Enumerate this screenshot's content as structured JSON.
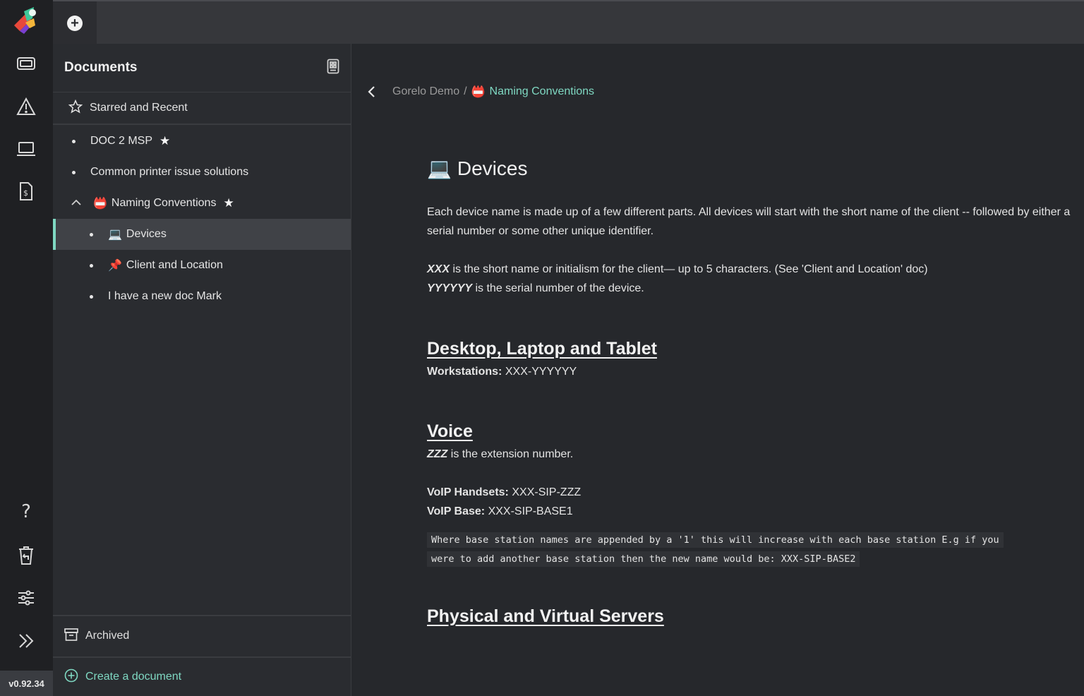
{
  "app": {
    "version": "v0.92.34"
  },
  "rail": {
    "icons": [
      "tickets-icon",
      "alert-icon",
      "laptop-icon",
      "invoice-icon",
      "help-icon",
      "trash-restore-icon",
      "settings-sliders-icon",
      "expand-icon"
    ]
  },
  "docs": {
    "title": "Documents",
    "starred_label": "Starred and Recent",
    "items": [
      {
        "label": "DOC 2 MSP",
        "starred": true
      },
      {
        "label": "Common printer issue solutions",
        "starred": false
      },
      {
        "label": "Naming Conventions",
        "emoji": "📛",
        "starred": true,
        "expanded": true
      },
      {
        "label": "Devices",
        "emoji": "💻",
        "active": true
      },
      {
        "label": "Client and Location",
        "emoji": "📌"
      },
      {
        "label": "I have a new doc Mark"
      }
    ],
    "archived_label": "Archived",
    "create_label": "Create a document"
  },
  "breadcrumb": {
    "parent": "Gorelo Demo",
    "separator": "/",
    "current_emoji": "📛",
    "current": "Naming Conventions"
  },
  "page": {
    "emoji": "💻",
    "title": "Devices",
    "intro": "Each device name is made up of a few different parts. All devices will start with the short name of the client -- followed by either a serial number or some other unique identifier.",
    "xxx_term": "XXX",
    "xxx_desc": "is the short name or initialism for the client— up to 5 characters. (See 'Client and Location' doc)",
    "yyy_term": "YYYYYY",
    "yyy_desc": "is the serial number of the device.",
    "section1_title": "Desktop, Laptop and Tablet",
    "workstations_label": "Workstations:",
    "workstations_value": "XXX-YYYYYY",
    "section2_title": "Voice",
    "zzz_term": "ZZZ",
    "zzz_desc": "is the extension number.",
    "voip_handsets_label": "VoIP Handsets:",
    "voip_handsets_value": "XXX-SIP-ZZZ",
    "voip_base_label": "VoIP Base:",
    "voip_base_value": "XXX-SIP-BASE1",
    "code_line1": "Where base station names are appended by a '1' this will increase with each base station E.g if you",
    "code_line2": "were to add another base station then the new name would be: XXX-SIP-BASE2",
    "section3_title": "Physical and Virtual Servers"
  },
  "colors": {
    "accent": "#7fd8c2",
    "rail_bg": "#1f2023",
    "sidebar_bg": "#2a2c30",
    "main_bg": "#26282c",
    "active_bg": "#404247"
  }
}
